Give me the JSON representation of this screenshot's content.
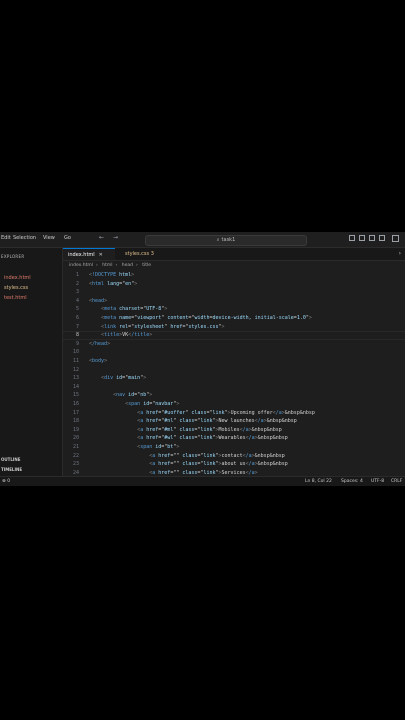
{
  "menubar": {
    "items": [
      "Edit",
      "Selection",
      "View",
      "Go"
    ],
    "search": "task1",
    "back": "←",
    "forward": "→"
  },
  "sidebar": {
    "title": "EXPLORER",
    "files": [
      {
        "name": "index.html",
        "color": "#e07c6b"
      },
      {
        "name": "styles.css",
        "color": "#e2c08d"
      },
      {
        "name": "test.html",
        "color": "#e07c6b"
      }
    ],
    "sections": [
      "OUTLINE",
      "TIMELINE"
    ]
  },
  "tabs": [
    {
      "label": "index.html",
      "active": true
    },
    {
      "label": "styles.css 3",
      "active": false
    }
  ],
  "breadcrumb": [
    "index.html",
    "html",
    "head",
    "title"
  ],
  "editor": {
    "current_line": 8,
    "lines": [
      {
        "n": 1,
        "t": "<!DOCTYPE html>"
      },
      {
        "n": 2,
        "t": "<html lang=\"en\">"
      },
      {
        "n": 3,
        "t": ""
      },
      {
        "n": 4,
        "t": "<head>"
      },
      {
        "n": 5,
        "t": "    <meta charset=\"UTF-8\">"
      },
      {
        "n": 6,
        "t": "    <meta name=\"viewport\" content=\"width=device-width, initial-scale=1.0\">"
      },
      {
        "n": 7,
        "t": "    <link rel=\"stylesheet\" href=\"styles.css\">"
      },
      {
        "n": 8,
        "t": "    <title>VK</title>"
      },
      {
        "n": 9,
        "t": "</head>"
      },
      {
        "n": 10,
        "t": ""
      },
      {
        "n": 11,
        "t": "<body>"
      },
      {
        "n": 12,
        "t": ""
      },
      {
        "n": 13,
        "t": "    <div id=\"main\">"
      },
      {
        "n": 14,
        "t": ""
      },
      {
        "n": 15,
        "t": "        <nav id=\"nb\">"
      },
      {
        "n": 16,
        "t": "            <span id=\"navbar\">"
      },
      {
        "n": 17,
        "t": "                <a href=\"#uoffer\" class=\"link\">Upcoming offer</a>&nbsp&nbsp"
      },
      {
        "n": 18,
        "t": "                <a href=\"#nl\" class=\"link\">New launches</a>&nbsp&nbsp"
      },
      {
        "n": 19,
        "t": "                <a href=\"#ml\" class=\"link\">Mobiles</a>&nbsp&nbsp"
      },
      {
        "n": 20,
        "t": "                <a href=\"#wl\" class=\"link\">Wearables</a>&nbsp&nbsp"
      },
      {
        "n": 21,
        "t": "                <span id=\"bt\">"
      },
      {
        "n": 22,
        "t": "                    <a href=\"\" class=\"link\">contact</a>&nbsp&nbsp"
      },
      {
        "n": 23,
        "t": "                    <a href=\"\" class=\"link\">about us</a>&nbsp&nbsp"
      },
      {
        "n": 24,
        "t": "                    <a href=\"\" class=\"link\">Services</a>"
      }
    ]
  },
  "statusbar": {
    "left": "⊗ 0",
    "position": "Ln 8, Col 22",
    "spaces": "Spaces: 4",
    "encoding": "UTF-8",
    "eol": "CRLF"
  },
  "colors": {
    "tag": "#569cd6",
    "attr": "#9cdcfe",
    "string": "#ce9178",
    "text": "#d4d4d4",
    "bracket": "#808080"
  }
}
